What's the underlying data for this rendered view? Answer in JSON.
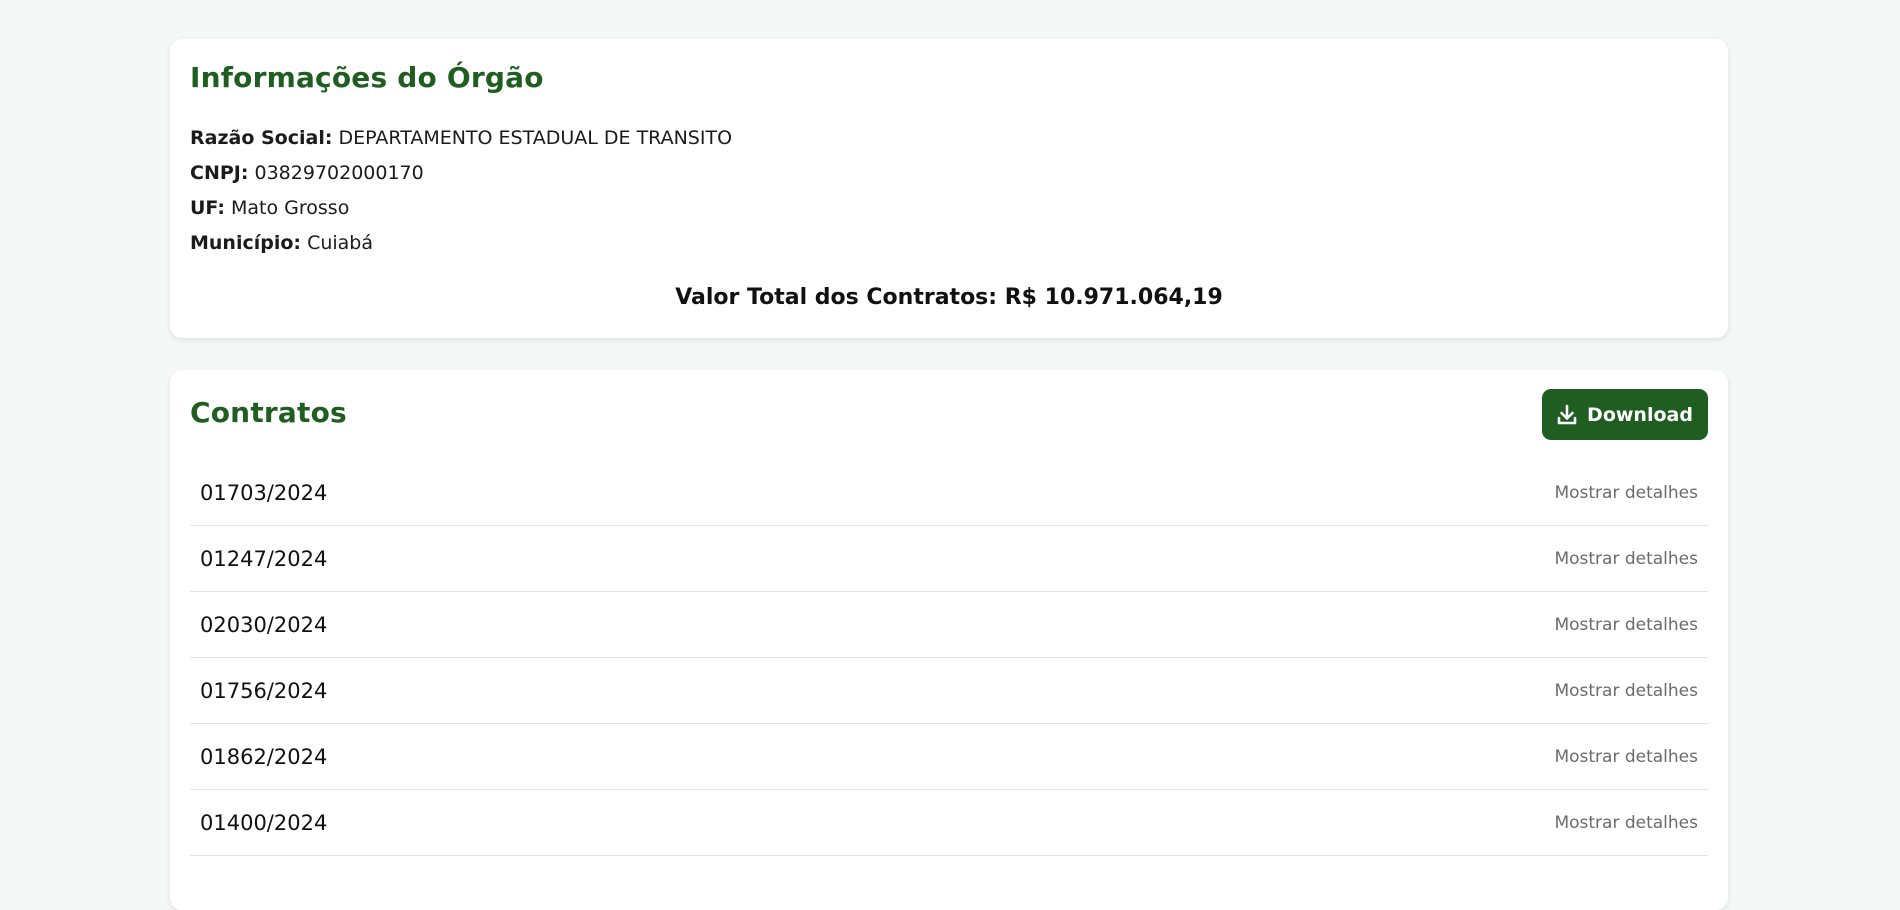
{
  "org_info": {
    "title": "Informações do Órgão",
    "fields": [
      {
        "label": "Razão Social:",
        "value": "DEPARTAMENTO ESTADUAL DE TRANSITO"
      },
      {
        "label": "CNPJ:",
        "value": "03829702000170"
      },
      {
        "label": "UF:",
        "value": "Mato Grosso"
      },
      {
        "label": "Município:",
        "value": "Cuiabá"
      }
    ],
    "total": "Valor Total dos Contratos: R$ 10.971.064,19"
  },
  "contracts": {
    "title": "Contratos",
    "download_label": "Download",
    "details_label": "Mostrar detalhes",
    "items": [
      {
        "number": "01703/2024"
      },
      {
        "number": "01247/2024"
      },
      {
        "number": "02030/2024"
      },
      {
        "number": "01756/2024"
      },
      {
        "number": "01862/2024"
      },
      {
        "number": "01400/2024"
      }
    ]
  },
  "colors": {
    "accent": "#1f5e20",
    "background": "#f4f8f7"
  },
  "icons": {
    "download": "download-icon"
  }
}
